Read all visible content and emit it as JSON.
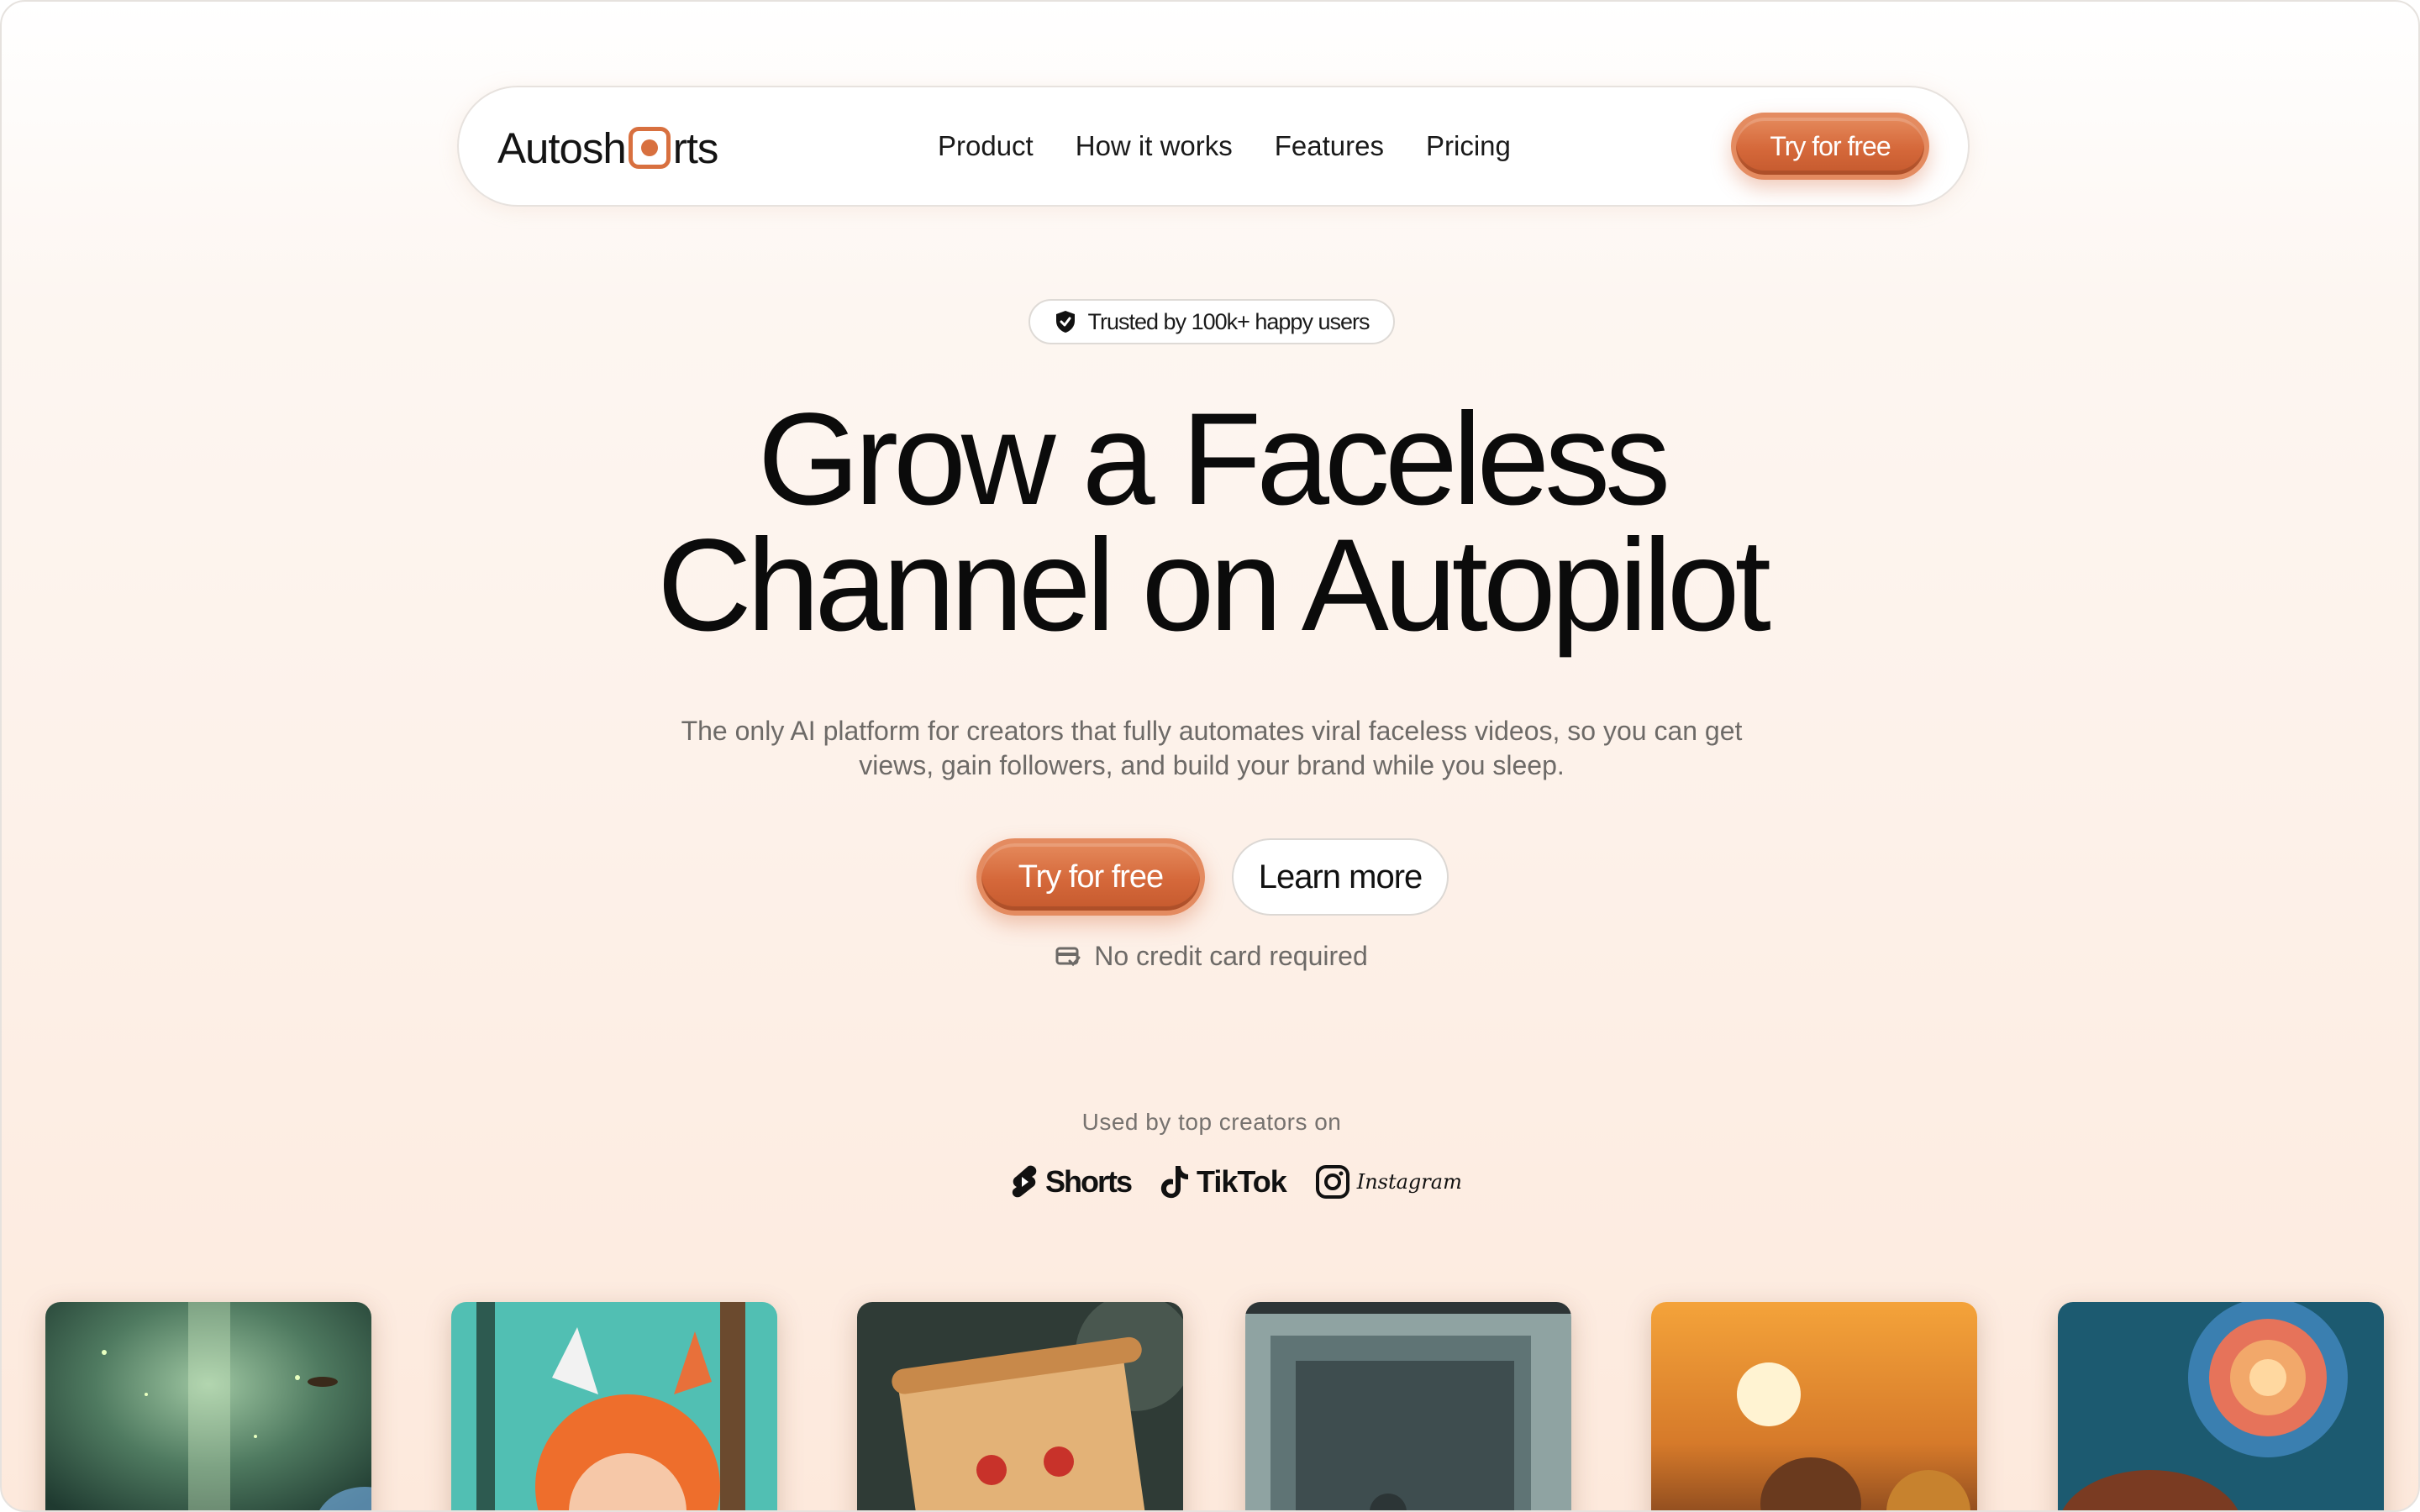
{
  "nav": {
    "logo_prefix": "Autosh",
    "logo_suffix": "rts",
    "links": [
      "Product",
      "How it works",
      "Features",
      "Pricing"
    ],
    "cta_label": "Try for free"
  },
  "badge": {
    "text": "Trusted by 100k+ happy users"
  },
  "hero": {
    "headline_line1": "Grow a Faceless",
    "headline_line2": "Channel on Autopilot",
    "subtext_line1": "The only AI platform for creators that fully automates viral faceless videos, so you can get",
    "subtext_line2": "views, gain followers, and build your brand while you sleep.",
    "primary_cta": "Try for free",
    "secondary_cta": "Learn more",
    "note": "No credit card required"
  },
  "social_proof": {
    "label": "Used by top creators on",
    "platforms": [
      "Shorts",
      "TikTok",
      "Instagram"
    ]
  },
  "thumbnails": [
    {
      "icon": "forest-light-firefly-image"
    },
    {
      "icon": "fox-girl-forest-image"
    },
    {
      "icon": "scroll-note-image"
    },
    {
      "icon": "vintage-photo-image"
    },
    {
      "icon": "sunset-figures-image"
    },
    {
      "icon": "swirling-nebula-image"
    }
  ],
  "colors": {
    "accent": "#d5683a",
    "accent_light": "#e58a5c",
    "text_dark": "#0b0b0b",
    "text_muted": "#6d6a67"
  }
}
